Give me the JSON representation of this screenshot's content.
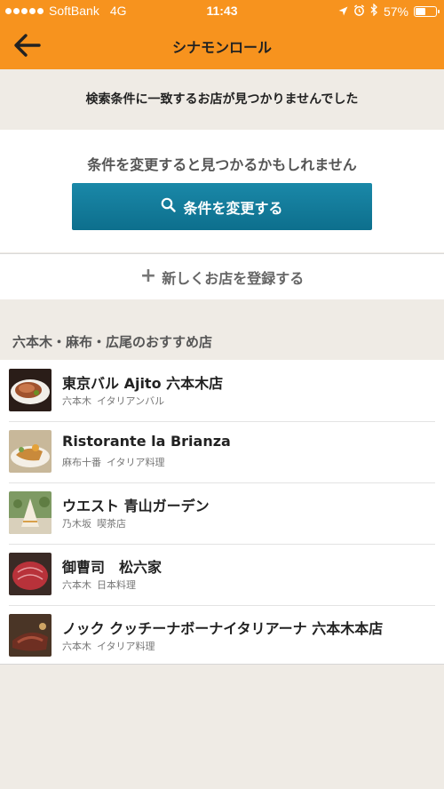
{
  "status_bar": {
    "carrier": "SoftBank",
    "network": "4G",
    "time": "11:43",
    "battery": "57%",
    "battery_level": 0.57,
    "signal_bars": 5,
    "icons": [
      "location-icon",
      "alarm-icon",
      "bluetooth-icon",
      "battery-icon"
    ]
  },
  "nav": {
    "title": "シナモンロール",
    "back_icon": "back-arrow-icon"
  },
  "no_result": {
    "message": "検索条件に一致するお店が見つかりませんでした"
  },
  "change": {
    "hint": "条件を変更すると見つかるかもしれません",
    "button_label": "条件を変更する",
    "button_icon": "search-icon",
    "button_color": "#107a9a"
  },
  "register": {
    "label": "新しくお店を登録する",
    "icon": "plus-icon"
  },
  "recommend": {
    "title": "六本木・麻布・広尾のおすすめ店",
    "shops": [
      {
        "name": "東京バル Ajito 六本木店",
        "area": "六本木",
        "genre": "イタリアンバル"
      },
      {
        "name": "Ristorante la Brianza",
        "area": "麻布十番",
        "genre": "イタリア料理"
      },
      {
        "name": "ウエスト 青山ガーデン",
        "area": "乃木坂",
        "genre": "喫茶店"
      },
      {
        "name": "御曹司　松六家",
        "area": "六本木",
        "genre": "日本料理"
      },
      {
        "name": "ノック クッチーナボーナイタリアーナ 六本木本店",
        "area": "六本木",
        "genre": "イタリア料理"
      }
    ]
  },
  "colors": {
    "header": "#f7931e",
    "background": "#efebe5",
    "button": "#107a9a"
  }
}
